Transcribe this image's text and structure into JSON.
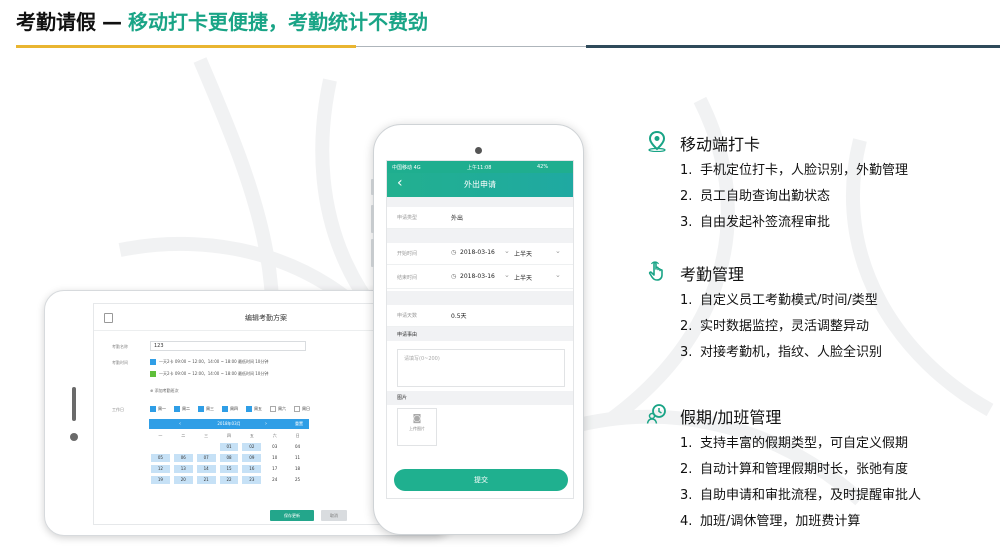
{
  "header": {
    "title": "考勤请假",
    "dash": "—",
    "subtitle": "移动打卡更便捷，考勤统计不费劲"
  },
  "colors": {
    "accent_green": "#19a486",
    "accent_yellow": "#e9b531",
    "accent_dark": "#2f4a5a",
    "calendar_blue": "#2f9ee6"
  },
  "tablet": {
    "title": "编辑考勤方案",
    "name_label": "考勤名称",
    "name_value": "123",
    "time_label": "考勤时间",
    "shift1": "一天2卡  09:00 ~ 12:00，14:00 ~ 18:00   最低时间  10分钟",
    "shift2": "一天2卡  09:00 ~ 12:00，14:00 ~ 18:00   最低时间  10分钟",
    "add_shift": "添加考勤班次",
    "workday_label": "工作日",
    "weekdays": [
      "周一",
      "周二",
      "周三",
      "周四",
      "周五",
      "周六",
      "周日"
    ],
    "weekday_checked": [
      true,
      true,
      true,
      true,
      true,
      false,
      false
    ],
    "calendar_title": "2018年03月",
    "calendar_reset": "重置",
    "calendar_headers": [
      "一",
      "二",
      "三",
      "四",
      "五",
      "六",
      "日"
    ],
    "calendar_rows": [
      [
        "",
        "",
        "",
        "01",
        "02",
        "03",
        "04"
      ],
      [
        "05",
        "06",
        "07",
        "08",
        "09",
        "10",
        "11"
      ],
      [
        "12",
        "13",
        "14",
        "15",
        "16",
        "17",
        "18"
      ],
      [
        "19",
        "20",
        "21",
        "22",
        "23",
        "24",
        "25"
      ]
    ],
    "save_button": "保存更新",
    "cancel_button": "取消"
  },
  "phone": {
    "status_carrier": "中国移动  4G",
    "status_time": "上午11:08",
    "status_battery": "42%",
    "nav_title": "外出申请",
    "back_icon": "chevron-left-icon",
    "type_label": "申请类型",
    "type_value": "外出",
    "start_label": "开始时间",
    "start_date": "2018-03-16",
    "start_half": "上半天",
    "end_label": "结束时间",
    "end_date": "2018-03-16",
    "end_half": "上半天",
    "days_label": "申请天数",
    "days_value": "0.5天",
    "reason_label": "申请事由",
    "reason_placeholder": "请填写(0~200)",
    "image_label": "图片",
    "upload_label": "上传图片",
    "submit_button": "提交"
  },
  "features": [
    {
      "icon": "location-pin-icon",
      "title": "移动端打卡",
      "items": [
        {
          "num": "1.",
          "text": "手机定位打卡，人脸识别，外勤管理"
        },
        {
          "num": "2.",
          "text": "员工自助查询出勤状态"
        },
        {
          "num": "3.",
          "text": "自由发起补签流程审批"
        }
      ]
    },
    {
      "icon": "hand-tap-icon",
      "title": "考勤管理",
      "items": [
        {
          "num": "1.",
          "text": "自定义员工考勤模式/时间/类型"
        },
        {
          "num": "2.",
          "text": "实时数据监控，灵活调整异动"
        },
        {
          "num": "3.",
          "text": "对接考勤机，指纹、人脸全识别"
        }
      ]
    },
    {
      "icon": "person-clock-icon",
      "title": "假期/加班管理",
      "items": [
        {
          "num": "1.",
          "text": "支持丰富的假期类型，可自定义假期"
        },
        {
          "num": "2.",
          "text": "自动计算和管理假期时长，张弛有度"
        },
        {
          "num": "3.",
          "text": "自助申请和审批流程，及时提醒审批人"
        },
        {
          "num": "4.",
          "text": "加班/调休管理，加班费计算"
        }
      ]
    }
  ]
}
